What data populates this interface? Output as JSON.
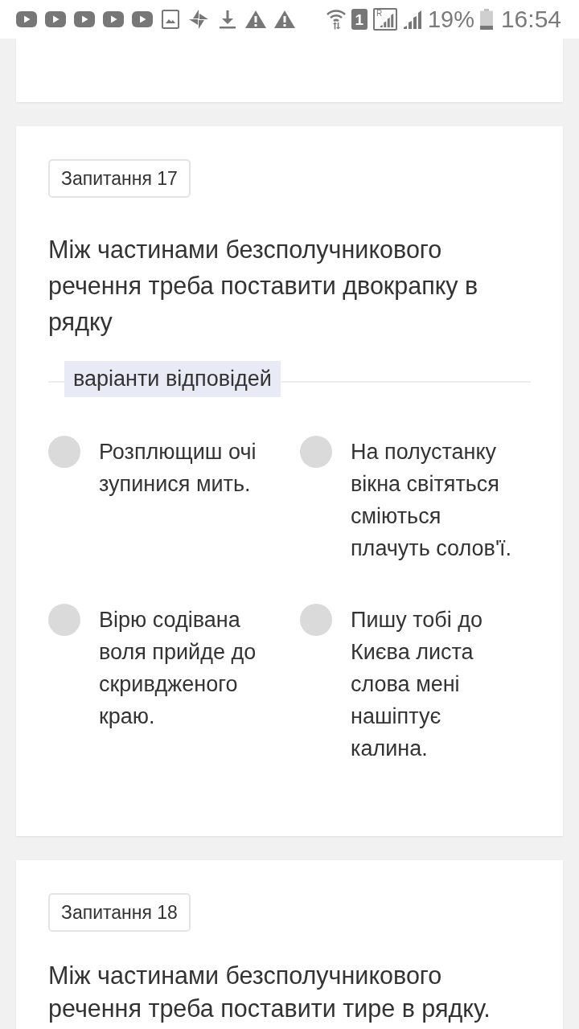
{
  "status_bar": {
    "sim_slot": "1",
    "roaming_label": "R",
    "battery": "19%",
    "time": "16:54"
  },
  "questions": [
    {
      "kind": "clipped_top"
    },
    {
      "kind": "full",
      "number_label": "Запитання 17",
      "prompt": "Між частинами безсполучникового речення треба поставити двокрапку в рядку",
      "answers_heading": "варіанти відповідей",
      "options": [
        {
          "text": "Розплющиш очі зупинися мить.",
          "selected": false
        },
        {
          "text": "На полустанку вікна світяться сміються плачуть солов'ї.",
          "selected": false
        },
        {
          "text": "Вірю содівана воля прийде до скривдженого краю.",
          "selected": false
        },
        {
          "text": "Пишу тобі до Києва листа слова мені нашіптує калина.",
          "selected": false
        }
      ]
    },
    {
      "kind": "clipped_bottom",
      "number_label": "Запитання 18",
      "prompt": "Між частинами безсполучникового речення треба поставити тире в рядку."
    }
  ]
}
